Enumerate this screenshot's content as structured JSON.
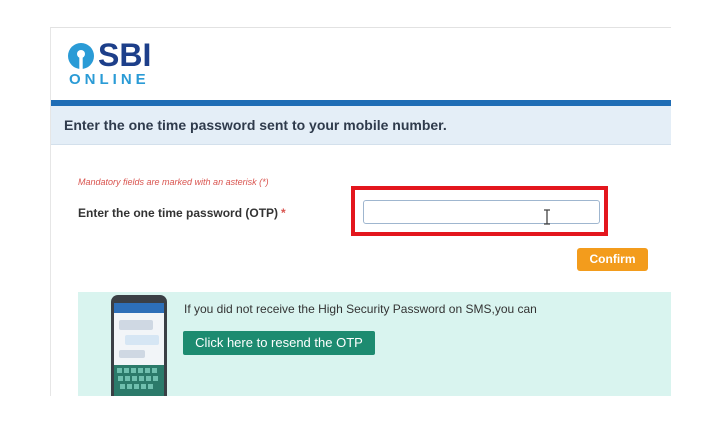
{
  "brand": {
    "name": "SBI",
    "tagline": "ONLINE"
  },
  "header": {
    "title": "Enter the one time password sent to your mobile number."
  },
  "form": {
    "mandatory_note": "Mandatory fields are marked with an asterisk (*)",
    "otp_label": "Enter the one time password (OTP)",
    "required_marker": "*",
    "otp_value": "",
    "confirm_label": "Confirm"
  },
  "resend": {
    "message": "If you did not receive the High Security Password on SMS,you can",
    "button_label": "Click here to resend the OTP"
  },
  "colors": {
    "brand_blue": "#1d3f8a",
    "brand_light_blue": "#2a9bd6",
    "highlight_red": "#e3161d",
    "confirm_orange": "#f39c1c",
    "resend_green": "#1d8b70",
    "panel_mint": "#d9f4ef"
  },
  "icons": {
    "logo": "sbi-keyhole-logo-icon",
    "cursor": "text-cursor-icon",
    "phone": "smartphone-icon"
  }
}
